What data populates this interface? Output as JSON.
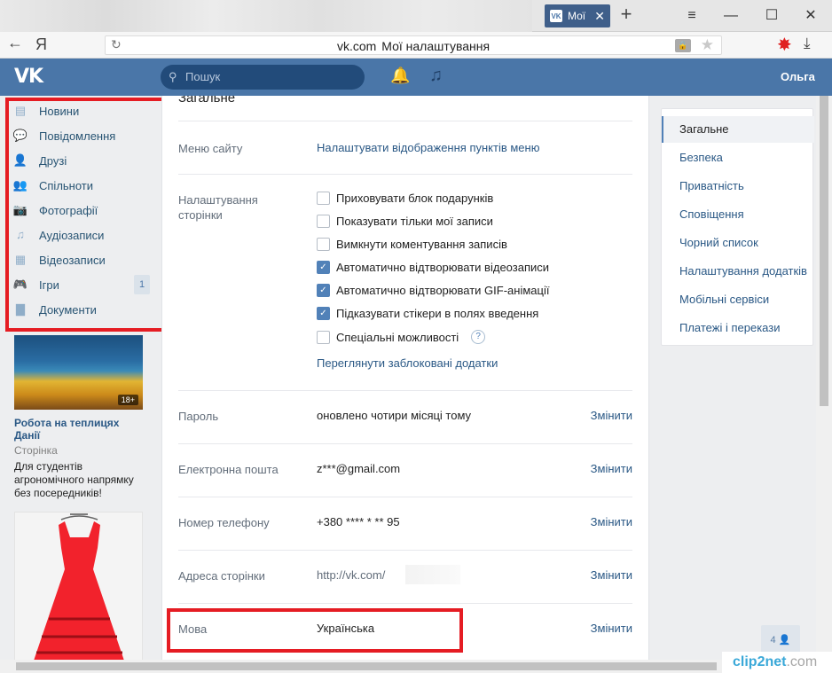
{
  "browser": {
    "tab_title": "Мої",
    "new_tab": "+",
    "back_label": "←",
    "brand_letter": "Я",
    "url_host": "vk.com",
    "page_title": "Мої налаштування"
  },
  "header": {
    "logo": "VK",
    "search_placeholder": "Пошук",
    "user_name": "Ольга"
  },
  "sidebar": {
    "items": [
      {
        "label": "Новини",
        "icon": "news-icon"
      },
      {
        "label": "Повідомлення",
        "icon": "messages-icon"
      },
      {
        "label": "Друзі",
        "icon": "friends-icon"
      },
      {
        "label": "Спільноти",
        "icon": "groups-icon"
      },
      {
        "label": "Фотографії",
        "icon": "camera-icon"
      },
      {
        "label": "Аудіозаписи",
        "icon": "music-note-icon"
      },
      {
        "label": "Відеозаписи",
        "icon": "film-icon"
      },
      {
        "label": "Ігри",
        "icon": "gamepad-icon",
        "count": "1"
      },
      {
        "label": "Документи",
        "icon": "document-icon"
      }
    ]
  },
  "ads": {
    "ad1": {
      "badge": "18+",
      "title": "Робота на теплицях Данії",
      "subtitle": "Сторінка",
      "description": "Для студентів агрономічного напрямку без посередників!"
    }
  },
  "settings": {
    "section_title": "Загальне",
    "site_menu": {
      "label": "Меню сайту",
      "link": "Налаштувати відображення пунктів меню"
    },
    "page_settings": {
      "label": "Налаштування сторінки",
      "options": [
        {
          "label": "Приховувати блок подарунків",
          "checked": false
        },
        {
          "label": "Показувати тільки мої записи",
          "checked": false
        },
        {
          "label": "Вимкнути коментування записів",
          "checked": false
        },
        {
          "label": "Автоматично відтворювати відеозаписи",
          "checked": true
        },
        {
          "label": "Автоматично відтворювати GIF-анімації",
          "checked": true
        },
        {
          "label": "Підказувати стікери в полях введення",
          "checked": true
        },
        {
          "label": "Спеціальні можливості",
          "checked": false
        }
      ],
      "help": "?",
      "blocked_apps_link": "Переглянути заблоковані додатки"
    },
    "password": {
      "label": "Пароль",
      "value": "оновлено чотири місяці тому",
      "action": "Змінити"
    },
    "email": {
      "label": "Електронна пошта",
      "value": "z***@gmail.com",
      "action": "Змінити"
    },
    "phone": {
      "label": "Номер телефону",
      "value": "+380 **** * ** 95",
      "action": "Змінити"
    },
    "address": {
      "label": "Адреса сторінки",
      "value": "http://vk.com/",
      "action": "Змінити"
    },
    "language": {
      "label": "Мова",
      "value": "Українська",
      "action": "Змінити"
    }
  },
  "right_menu": {
    "items": [
      "Загальне",
      "Безпека",
      "Приватність",
      "Сповіщення",
      "Чорний список",
      "Налаштування додатків",
      "Мобільні сервіси",
      "Платежі і перекази"
    ],
    "active_index": 0
  },
  "friends_online": {
    "count": "4"
  },
  "watermark": {
    "brand": "clip2net",
    "suffix": ".com"
  },
  "colors": {
    "header": "#4a76a8",
    "link": "#2a5885",
    "highlight": "#e51c23",
    "checkbox": "#5181b8"
  }
}
